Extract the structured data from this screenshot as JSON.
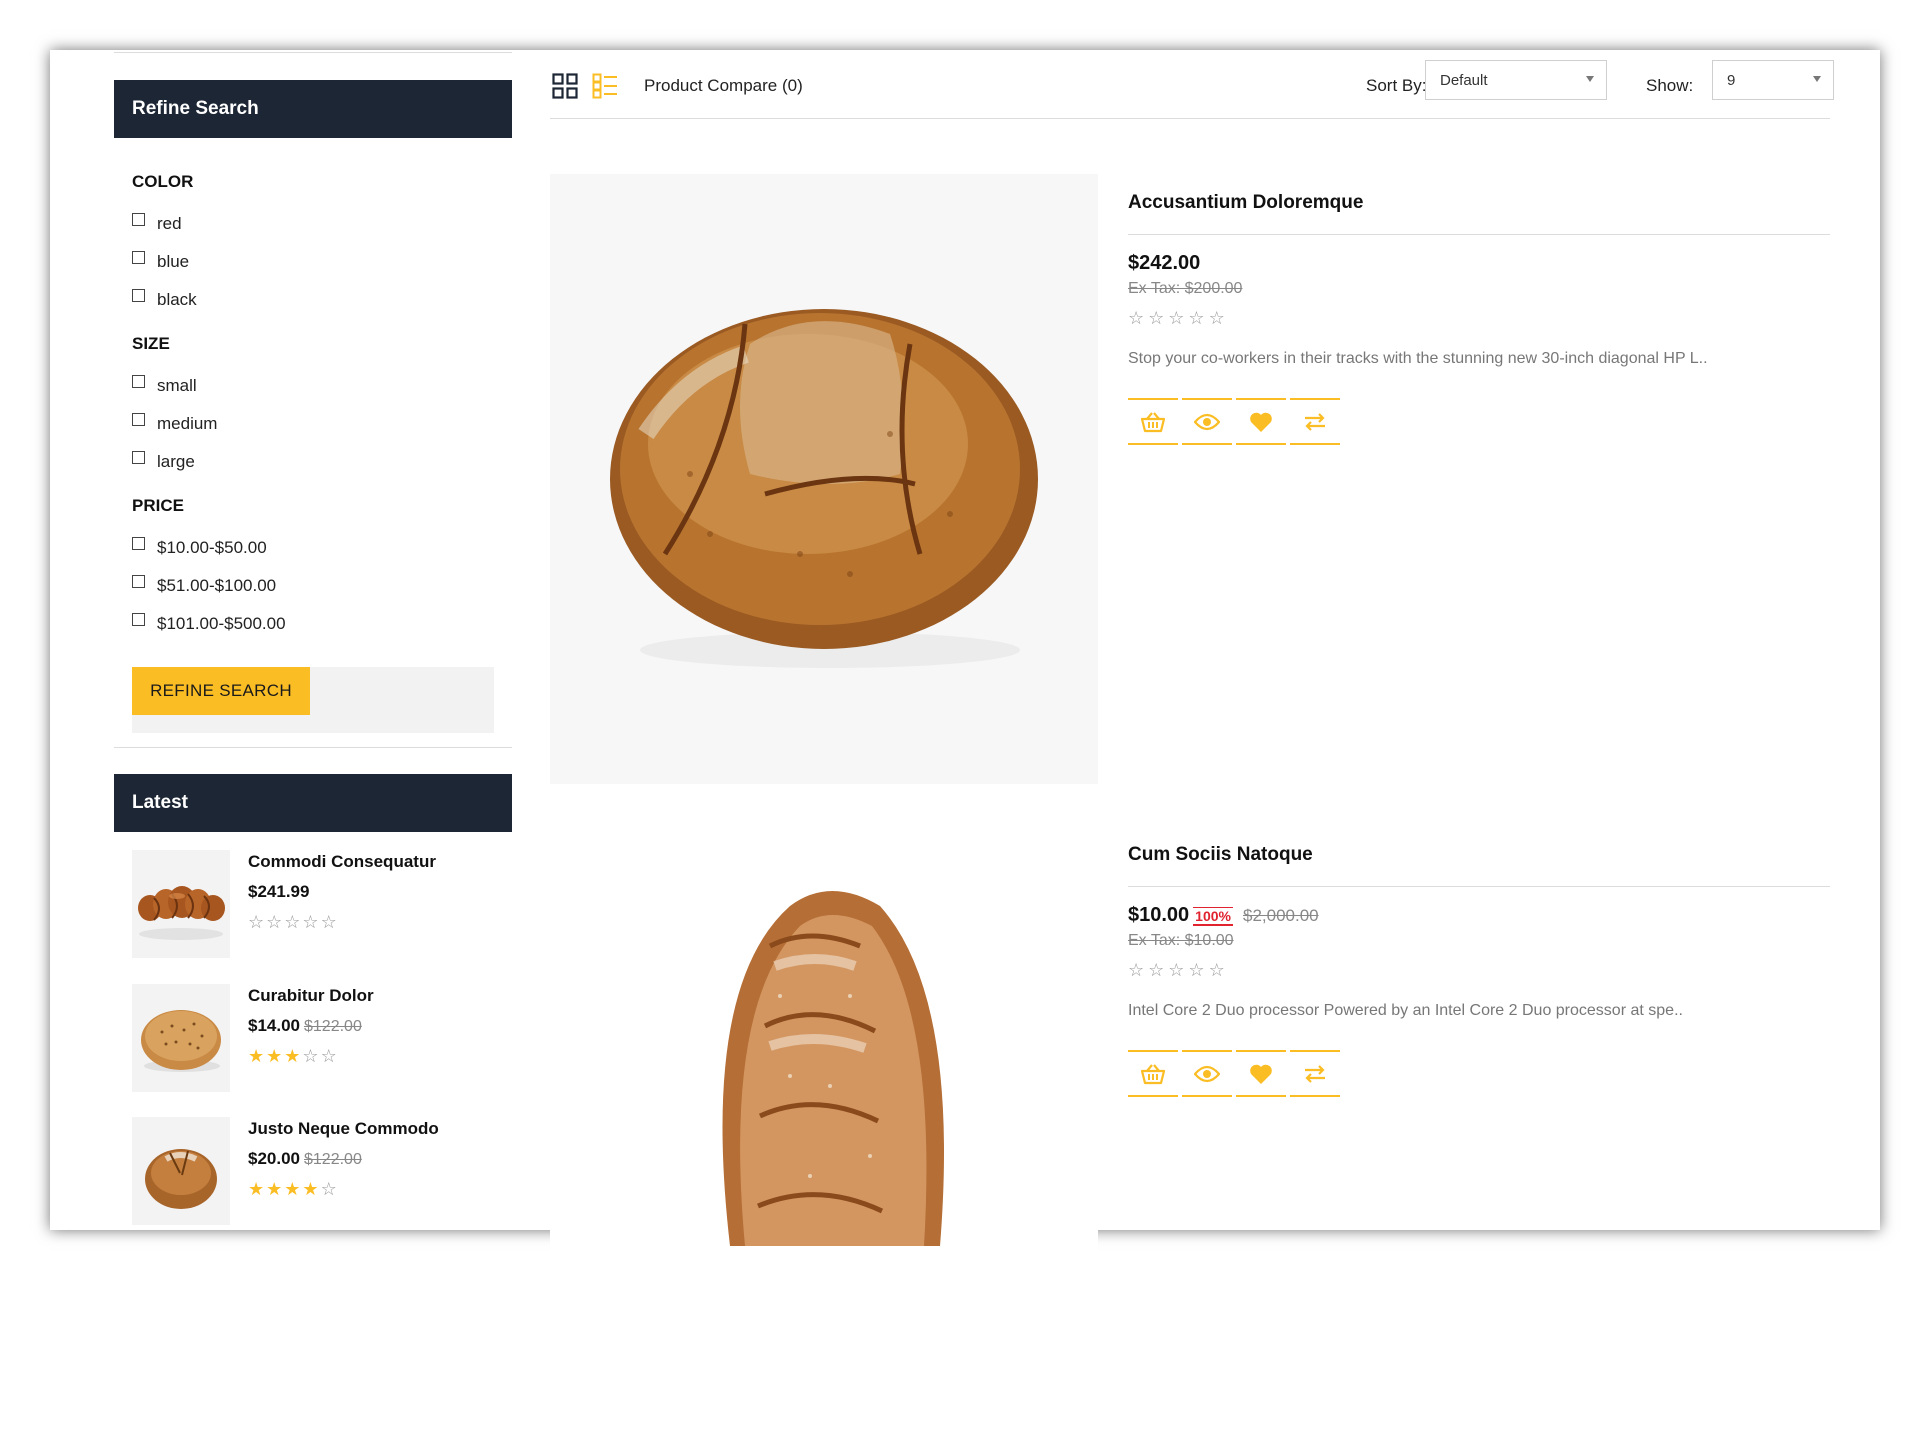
{
  "sidebar": {
    "refine": {
      "title": "Refine Search",
      "groups": [
        {
          "title": "COLOR",
          "options": [
            "red",
            "blue",
            "black"
          ]
        },
        {
          "title": "SIZE",
          "options": [
            "small",
            "medium",
            "large"
          ]
        },
        {
          "title": "PRICE",
          "options": [
            "$10.00-$50.00",
            "$51.00-$100.00",
            "$101.00-$500.00"
          ]
        }
      ],
      "button_label": "REFINE SEARCH"
    },
    "latest": {
      "title": "Latest",
      "items": [
        {
          "name": "Commodi Consequatur",
          "price": "$241.99",
          "old_price": "",
          "rating": 0
        },
        {
          "name": "Curabitur Dolor",
          "price": "$14.00",
          "old_price": "$122.00",
          "rating": 3
        },
        {
          "name": "Justo Neque Commodo",
          "price": "$20.00",
          "old_price": "$122.00",
          "rating": 4
        }
      ]
    }
  },
  "toolbar": {
    "compare_label": "Product Compare (0)",
    "sort_label": "Sort By:",
    "sort_value": "Default",
    "show_label": "Show:",
    "show_value": "9"
  },
  "products": [
    {
      "name": "Accusantium Doloremque",
      "price": "$242.00",
      "discount_badge": "",
      "old_price": "",
      "ex_tax": "Ex Tax: $200.00",
      "rating": 0,
      "description": "Stop your co-workers in their tracks with the stunning new 30-inch diagonal HP L.."
    },
    {
      "name": "Cum Sociis Natoque",
      "price": "$10.00",
      "discount_badge": "100%",
      "old_price": "$2,000.00",
      "ex_tax": "Ex Tax: $10.00",
      "rating": 0,
      "description": "Intel Core 2 Duo processor Powered by an Intel Core 2 Duo processor at spe.."
    }
  ],
  "icons": {
    "grid_view": "grid-icon",
    "list_view": "list-icon",
    "cart": "basket-icon",
    "quick_view": "eye-icon",
    "wishlist": "heart-icon",
    "compare": "compare-arrows-icon"
  },
  "colors": {
    "accent": "#fbbd24",
    "header_bg": "#1c2634",
    "sale_badge": "#e0232f"
  }
}
